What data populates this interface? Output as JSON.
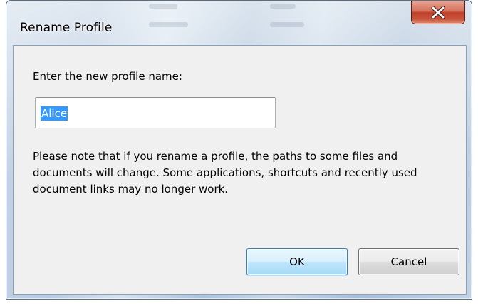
{
  "window": {
    "title": "Rename Profile",
    "close_icon": "close-x-icon"
  },
  "dialog": {
    "prompt_label": "Enter the new profile name:",
    "name_input": {
      "value": "Alice",
      "selected": true
    },
    "note": "Please note that if you rename a profile, the paths to some files and documents will change. Some applications, shortcuts and recently used document links may no longer work.",
    "buttons": {
      "ok_label": "OK",
      "cancel_label": "Cancel"
    }
  },
  "colors": {
    "selection_highlight": "#3399ff",
    "close_button": "#c7492f",
    "client_background": "#f0f0f0"
  }
}
